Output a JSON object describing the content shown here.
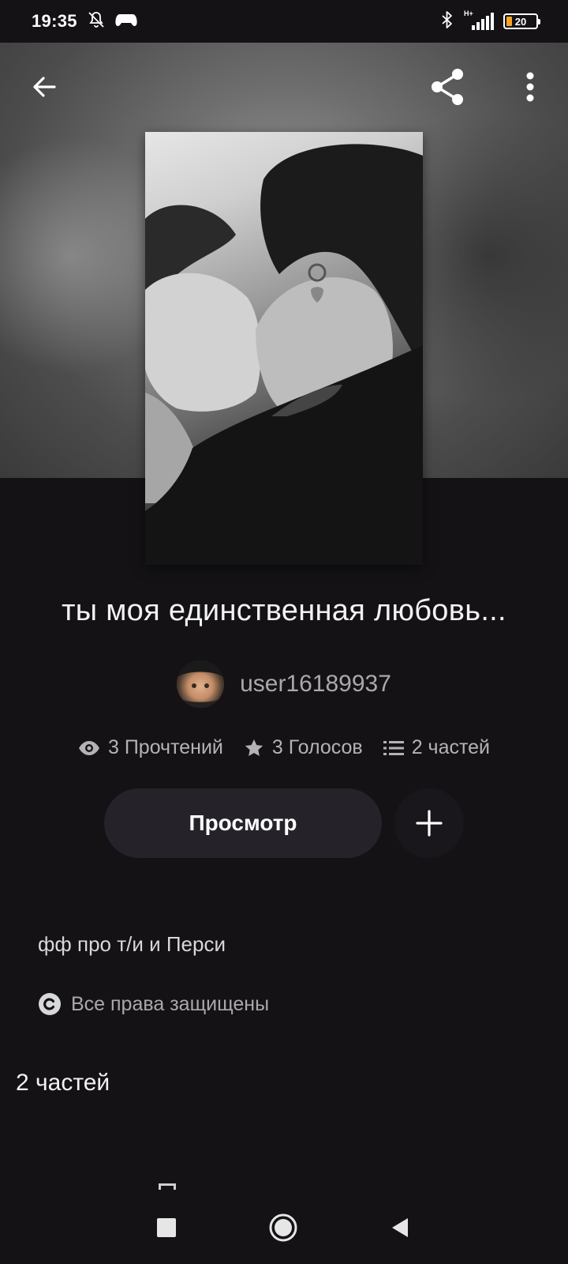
{
  "status_bar": {
    "time": "19:35",
    "battery": "20",
    "network": "H+",
    "icons": [
      "mute-bell-icon",
      "gamepad-icon",
      "bluetooth-icon",
      "signal-icon",
      "battery-icon"
    ]
  },
  "toolbar": {
    "icons": [
      "arrow-left-icon",
      "share-icon",
      "more-vertical-icon"
    ]
  },
  "story": {
    "title": "ты моя единственная любовь...",
    "author": "user16189937",
    "description": "фф про т/и и Перси",
    "copyright": "Все права защищены"
  },
  "stats": {
    "reads": "3 Прочтений",
    "votes": "3 Голосов",
    "parts": "2 частей"
  },
  "actions": {
    "read_label": "Просмотр",
    "add_icon": "plus-icon"
  },
  "parts_section": {
    "heading": "2 частей"
  },
  "nav_bar": {
    "icons": [
      "recents-square-icon",
      "home-circle-icon",
      "back-triangle-icon"
    ]
  },
  "colors": {
    "background": "#141215",
    "button": "#252329",
    "muted_text": "#a9a9ad",
    "battery_accent": "#f5a524"
  }
}
